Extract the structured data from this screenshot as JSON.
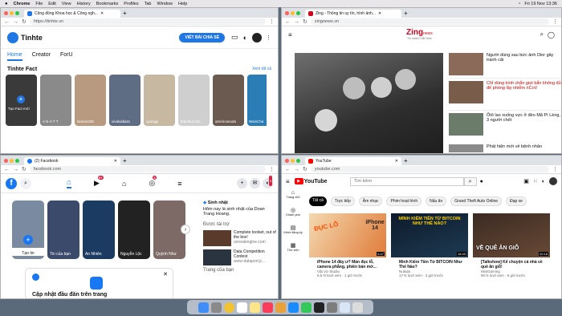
{
  "menubar": {
    "apple": "",
    "app": "Chrome",
    "items": [
      "File",
      "Edit",
      "View",
      "History",
      "Bookmarks",
      "Profiles",
      "Tab",
      "Window",
      "Help"
    ],
    "clock": "Fri 19 Nov 13:36"
  },
  "tinhte": {
    "tab": "Cộng đồng Khoa học & Công ngh...",
    "url": "https://tinhte.vn",
    "logo": "Tinhte",
    "cta": "VIẾT BÀI CHIA SẺ",
    "badge": "1",
    "tabs": [
      "Home",
      "Creator",
      "ForU"
    ],
    "section": "Tinhte Fact",
    "see_all": "Xem tất cả",
    "first_card": "Tạo Fact mới",
    "cards": [
      "A N H T T",
      "lamlan338",
      "vivaloidia11",
      "quangp",
      "thanhluc102",
      "americanoda",
      "WainCha"
    ]
  },
  "zing": {
    "tab": "Zing - Thông tin uy tín, hình ảnh...",
    "url": "zingnews.vn",
    "logo": "Zing",
    "logo_sub": "news",
    "tagline": "Tin nhanh Việt Nam",
    "news": [
      "Người dùng sau bức ảnh Dior gây tranh cãi",
      "Chỉ dùng kính chắn giọt bắn không đủ để phòng lây nhiễm nCoV",
      "Ốtô lao xuống vực ở đèo Mã Pí Lèng, 3 người chết",
      "Phát hiện mới về bệnh nhân"
    ]
  },
  "facebook": {
    "tab": "(2) Facebook",
    "url": "facebook.com",
    "badge_video": "9+",
    "badge_group": "2",
    "badge_notif": "1",
    "story_create": "Tạo tin",
    "stories": [
      "Tin của bạn",
      "An Nhiên",
      "Nguyễn Lộc",
      "Quỳnh Như"
    ],
    "birthday_title": "Sinh nhật",
    "birthday_text": "Hôm nay là sinh nhật của Doan Trang Hoang.",
    "sponsored": "Được tài trợ",
    "ads": [
      {
        "title": "Complete toolset, out of the box!",
        "site": "unrealengine.com"
      },
      {
        "title": "Data Competition Contest",
        "site": "www-dataport.jt..."
      }
    ],
    "pages": "Trang của bạn",
    "update_title": "Cập nhật đầu đăn trên trang"
  },
  "youtube": {
    "tab": "YouTube",
    "url": "youtube.com",
    "logo": "YouTube",
    "search_placeholder": "Tìm kiếm",
    "chips": [
      "Tất cả",
      "Trực tiếp",
      "Âm nhạc",
      "Phim hoạt hình",
      "Nấu ăn",
      "Grand Theft Auto Online",
      "Đạp xe"
    ],
    "side": [
      "Trang chủ",
      "Khám phá",
      "Kênh đăng ký",
      "Thư viện"
    ],
    "videos": [
      {
        "title": "iPhone 14 đây ư? Màn đục lỗ, camera phẳng, phiên bản mớ...",
        "channel": "Vật Vờ Studio",
        "meta": "6,5 N lượt xem · 1 giờ trước",
        "dur": "6:47",
        "thumb": "ĐỤC LỖ",
        "thumb2": "iPhone 14"
      },
      {
        "title": "Minh Kiếm Tiền Từ BITCOIN Như Thế Nào?",
        "channel": "Nukida",
        "meta": "17 N lượt xem · 2 giờ trước",
        "dur": "18:40",
        "thumb": "MÌNH KIẾM TIỀN TỪ BITCOIN NHƯ THẾ NÀO?"
      },
      {
        "title": "[Talkshow] Kể chuyện cả nhà về quê ăn giỗ!",
        "channel": "MixiGaming",
        "meta": "90 N lượt xem · 5 giờ trước",
        "dur": "20:18",
        "thumb": "VỀ QUÊ ĂN GIỖ"
      }
    ]
  },
  "colors": {
    "fb": "#1877f2",
    "yt": "#ff0000",
    "tinhte": "#1f77e5",
    "zing": "#d0021b"
  }
}
